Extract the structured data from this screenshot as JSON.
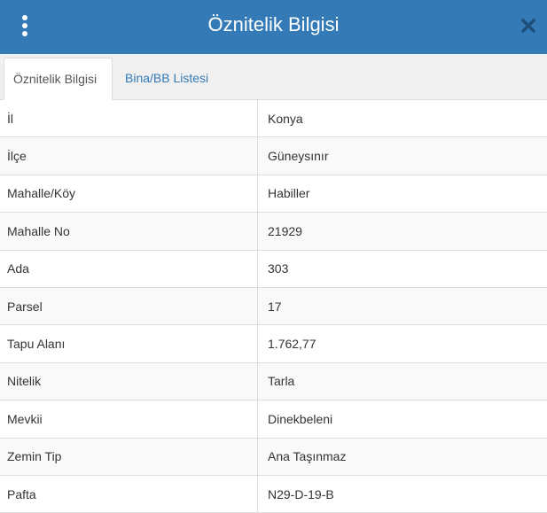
{
  "header": {
    "title": "Öznitelik Bilgisi",
    "menu_icon": "vertical-ellipsis-icon",
    "close_icon": "close-icon",
    "background_color": "#337ab7"
  },
  "tabs": [
    {
      "label": "Öznitelik Bilgisi",
      "active": true
    },
    {
      "label": "Bina/BB Listesi",
      "active": false
    }
  ],
  "attributes": [
    {
      "key": "İl",
      "value": "Konya"
    },
    {
      "key": "İlçe",
      "value": "Güneysınır"
    },
    {
      "key": "Mahalle/Köy",
      "value": "Habiller"
    },
    {
      "key": "Mahalle No",
      "value": "21929"
    },
    {
      "key": "Ada",
      "value": "303"
    },
    {
      "key": "Parsel",
      "value": "17"
    },
    {
      "key": "Tapu Alanı",
      "value": "1.762,77"
    },
    {
      "key": "Nitelik",
      "value": "Tarla"
    },
    {
      "key": "Mevkii",
      "value": "Dinekbeleni"
    },
    {
      "key": "Zemin Tip",
      "value": "Ana Taşınmaz"
    },
    {
      "key": "Pafta",
      "value": "N29-D-19-B"
    }
  ]
}
